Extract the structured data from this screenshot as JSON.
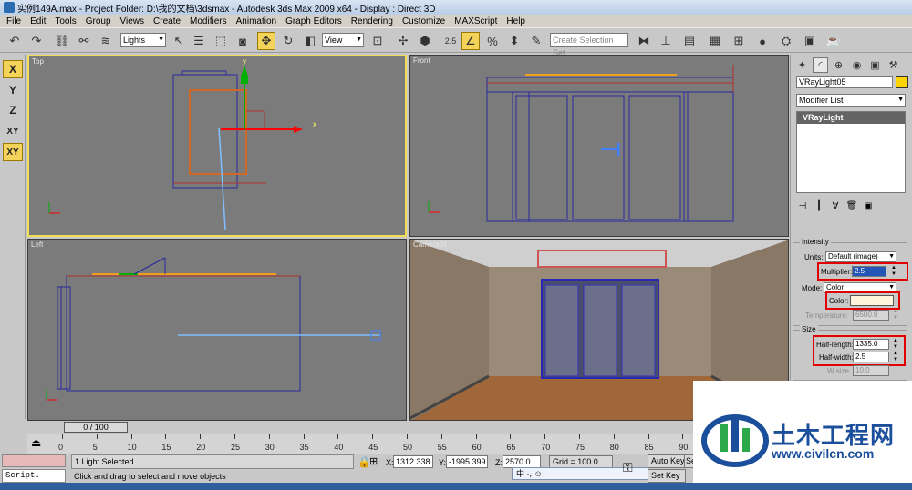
{
  "window": {
    "title": "实例149A.max  - Project Folder: D:\\我的文档\\3dsmax    - Autodesk 3ds Max  2009 x64      - Display : Direct 3D"
  },
  "menu": [
    "File",
    "Edit",
    "Tools",
    "Group",
    "Views",
    "Create",
    "Modifiers",
    "Animation",
    "Graph Editors",
    "Rendering",
    "Customize",
    "MAXScript",
    "Help"
  ],
  "toolbar": {
    "selection_filter": "Lights",
    "reference_coord": "View",
    "named_selection_placeholder": "Create Selection Set",
    "snap_label": "2.5"
  },
  "axis_buttons": [
    "X",
    "Y",
    "Z",
    "XY",
    "XY"
  ],
  "viewports": {
    "top": "Top",
    "front": "Front",
    "left": "Left",
    "camera": "Camera01"
  },
  "command_panel": {
    "object_name": "VRayLight05",
    "modifier_list": "Modifier List",
    "stack_item": "VRayLight",
    "intensity_title": "Intensity",
    "units_label": "Units:",
    "units_value": "Default (image)",
    "multiplier_label": "Multiplier:",
    "multiplier_value": "2.5",
    "mode_label": "Mode:",
    "mode_value": "Color",
    "color_label": "Color:",
    "color_value": "#fff4dc",
    "temperature_label": "Temperature:",
    "temperature_value": "6500.0",
    "size_title": "Size",
    "half_length_label": "Half-length:",
    "half_length_value": "1335.0",
    "half_width_label": "Half-width:",
    "half_width_value": "2.5",
    "w_size_label": "W size",
    "w_size_value": "10.0"
  },
  "timeline": {
    "slider": "0 / 100",
    "ticks": [
      "0",
      "5",
      "10",
      "15",
      "20",
      "25",
      "30",
      "35",
      "40",
      "45",
      "50",
      "55",
      "60",
      "65",
      "70",
      "75",
      "80",
      "85",
      "90"
    ]
  },
  "status": {
    "selection": "1 Light Selected",
    "prompt": "Click and drag to select and move objects",
    "x_label": "X:",
    "x_value": "1312.338",
    "y_label": "Y:",
    "y_value": "-1995.399",
    "z_label": "Z:",
    "z_value": "2570.0",
    "grid": "Grid = 100.0",
    "auto_key": "Auto Key",
    "set_key": "Set Key",
    "sel": "Se",
    "script_label": "Script.",
    "ime": "中 ·, ☺"
  },
  "watermark": {
    "name": "土木工程网",
    "url": "www.civilcn.com"
  },
  "colors": {
    "active_yellow": "#f0dd55",
    "highlight_red": "#e00000",
    "gizmo_red": "#ff0000",
    "gizmo_green": "#00b000",
    "wire_blue": "#28289c",
    "wire_red": "#b03030",
    "light_orange": "#f0a020"
  }
}
